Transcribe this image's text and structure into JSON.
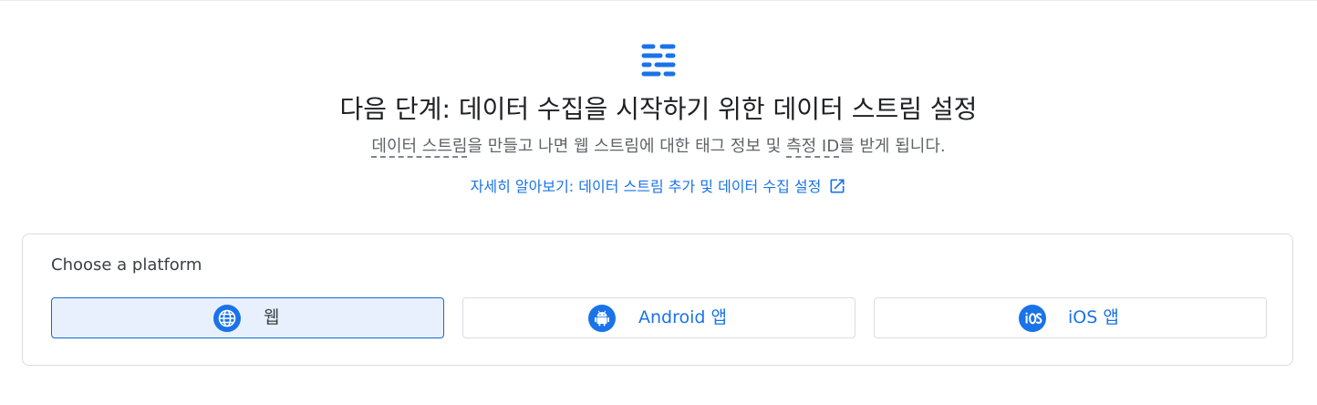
{
  "hero": {
    "icon": "data-stream-icon",
    "title": "다음 단계: 데이터 수집을 시작하기 위한 데이터 스트림 설정",
    "subtitle": {
      "term1": "데이터 스트림",
      "text1": "을 만들고 나면 웹 스트림에 대한 태그 정보 및 ",
      "term2": "측정 ID",
      "text2": "를 받게 됩니다."
    },
    "learn_more": "자세히 알아보기: 데이터 스트림 추가 및 데이터 수집 설정"
  },
  "platform": {
    "label": "Choose a platform",
    "selected": "web",
    "options": [
      {
        "id": "web",
        "label": "웹",
        "icon": "globe-icon"
      },
      {
        "id": "android",
        "label": "Android 앱",
        "icon": "android-icon"
      },
      {
        "id": "ios",
        "label": "iOS 앱",
        "icon": "ios-icon"
      }
    ]
  },
  "colors": {
    "accent": "#1a73e8",
    "selected_bg": "#e8f0fe",
    "selected_border": "#1967d2",
    "text_primary": "#202124",
    "text_secondary": "#5f6368"
  }
}
